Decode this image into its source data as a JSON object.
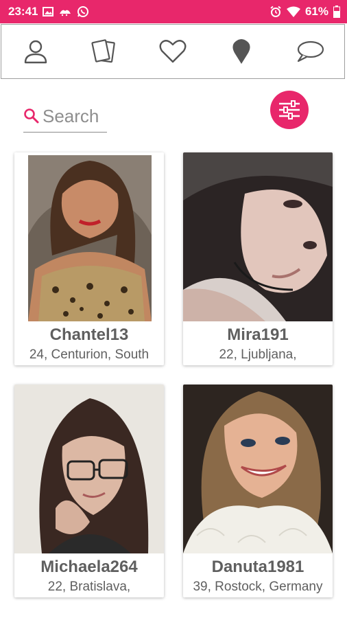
{
  "status_bar": {
    "time": "23:41",
    "battery": "61%",
    "left_icons": [
      "image-icon",
      "weather-icon",
      "whatsapp-icon"
    ],
    "right_icons": [
      "alarm-icon",
      "wifi-icon",
      "battery-icon"
    ]
  },
  "nav": {
    "items": [
      {
        "icon": "profile-icon"
      },
      {
        "icon": "cards-icon"
      },
      {
        "icon": "heart-icon"
      },
      {
        "icon": "location-pin-icon"
      },
      {
        "icon": "chat-bubble-icon"
      }
    ]
  },
  "search": {
    "placeholder": "Search",
    "value": ""
  },
  "colors": {
    "accent": "#e8276b",
    "text": "#5f5f5f",
    "nav_icon": "#555555"
  },
  "profiles": [
    {
      "name": "Chantel13",
      "details": "24, Centurion, South"
    },
    {
      "name": "Mira191",
      "details": "22, Ljubljana,"
    },
    {
      "name": "Michaela264",
      "details": "22, Bratislava,"
    },
    {
      "name": "Danuta1981",
      "details": "39, Rostock, Germany"
    }
  ]
}
